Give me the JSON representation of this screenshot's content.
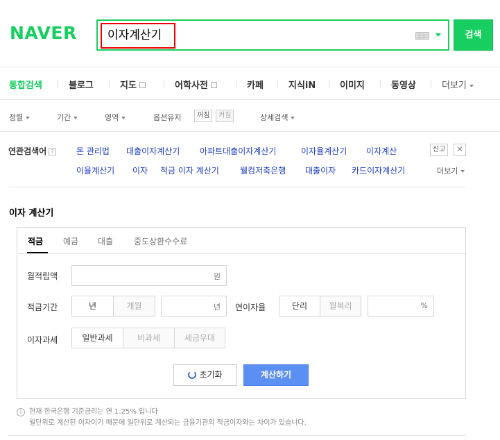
{
  "header": {
    "logo": "NAVER",
    "search_value": "이자계산기",
    "search_button": "검색"
  },
  "tabs": [
    {
      "label": "통합검색",
      "active": true
    },
    {
      "label": "블로그"
    },
    {
      "label": "지도"
    },
    {
      "label": "어학사전"
    },
    {
      "label": "카페"
    },
    {
      "label": "지식iN"
    },
    {
      "label": "이미지"
    },
    {
      "label": "동영상"
    },
    {
      "label": "더보기"
    }
  ],
  "options": {
    "sort": "정렬",
    "period": "기간",
    "area": "영역",
    "keep": "옵션유지",
    "toggle_off": "꺼짐",
    "toggle_on": "켜짐",
    "detail": "상세검색"
  },
  "related": {
    "title": "연관검색어",
    "help": "?",
    "links": [
      "돈 관리법",
      "대출이자계산기",
      "아파트대출이자계산기",
      "이자율계산기",
      "이자계산",
      "이율계산기",
      "이자",
      "적금 이자 계산기",
      "웰컴저축은행",
      "대출이자",
      "카드이자계산기"
    ],
    "report": "신고",
    "close": "✕",
    "more": "더보기"
  },
  "calculator": {
    "title": "이자 계산기",
    "tabs": [
      "적금",
      "예금",
      "대출",
      "중도상환수수료"
    ],
    "monthly_label": "월적립액",
    "monthly_unit": "원",
    "period_label": "적금기간",
    "period_year": "년",
    "period_month": "개월",
    "period_unit": "년",
    "rate_label": "연이자율",
    "rate_simple": "단리",
    "rate_compound": "월복리",
    "rate_unit": "%",
    "tax_label": "이자과세",
    "tax_general": "일반과세",
    "tax_exempt": "비과세",
    "tax_preferential": "세금우대",
    "reset": "초기화",
    "calculate": "계산하기"
  },
  "notes": {
    "info_icon": "i",
    "line1": "현재 한국은행 기준금리는 연 1.25% 입니다",
    "line2": "월단위로 계산된 이자이기 때문에 일단위로 계산되는 금융기관의 적금이자와는 차이가 있습니다."
  },
  "colors": {
    "brand": "#19ce60",
    "link": "#1f3fbf",
    "button_blue": "#5b8ff2",
    "highlight": "#ee0000"
  }
}
